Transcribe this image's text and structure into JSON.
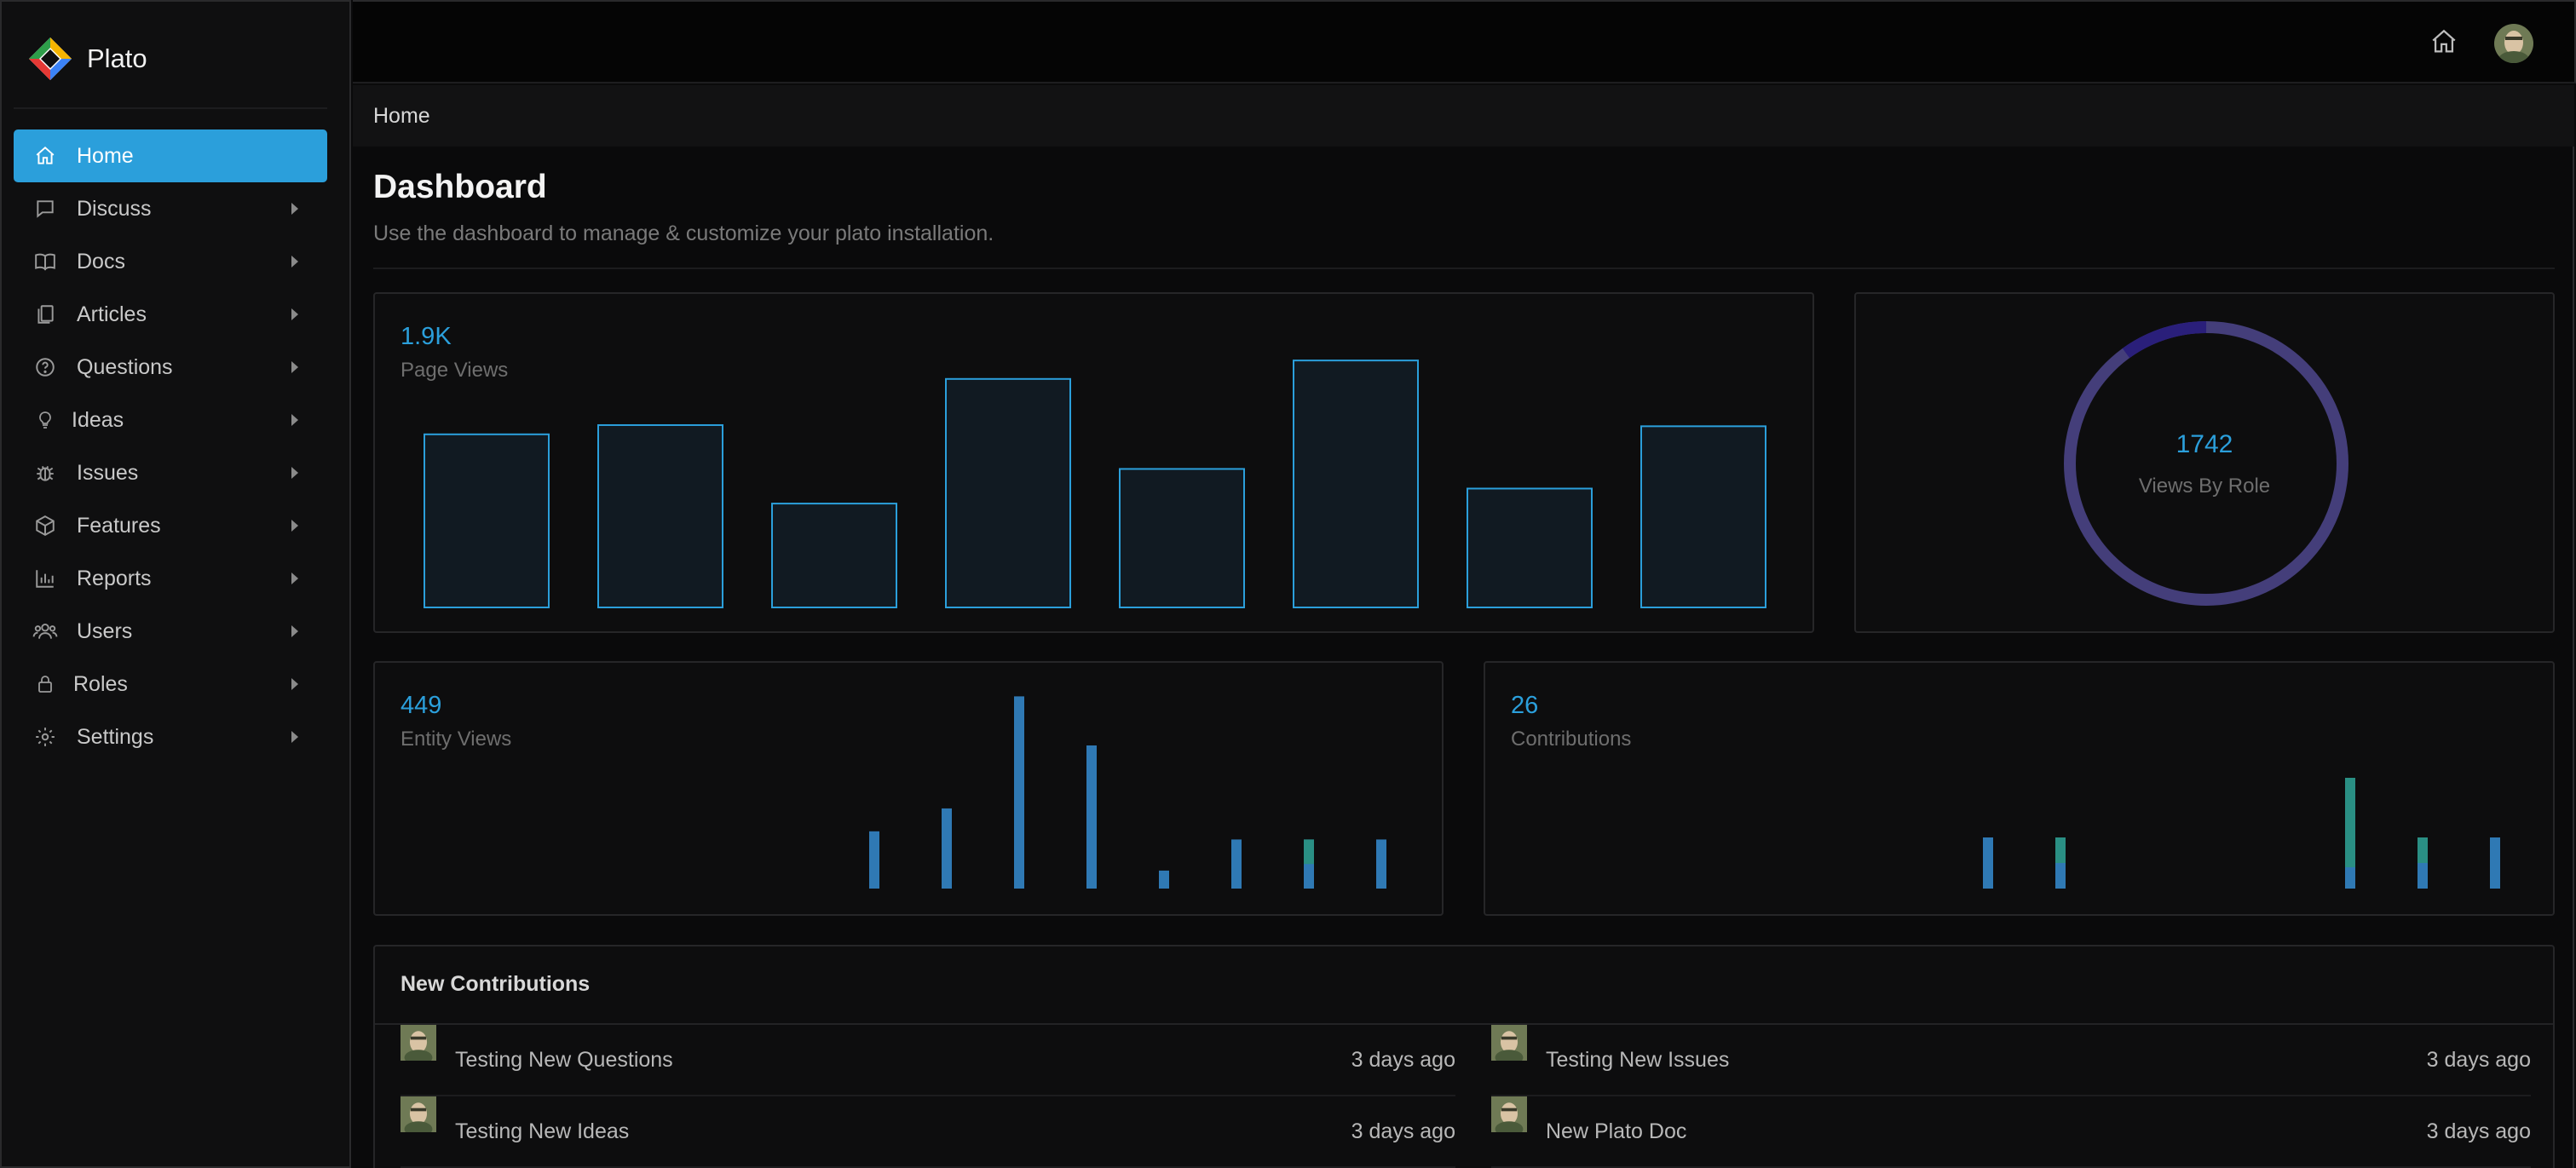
{
  "app": {
    "name": "Plato"
  },
  "sidebar": {
    "items": [
      {
        "label": "Home",
        "icon": "home-icon",
        "active": true,
        "caret": false
      },
      {
        "label": "Discuss",
        "icon": "chat-icon",
        "active": false,
        "caret": true
      },
      {
        "label": "Docs",
        "icon": "book-icon",
        "active": false,
        "caret": true
      },
      {
        "label": "Articles",
        "icon": "documents-icon",
        "active": false,
        "caret": true
      },
      {
        "label": "Questions",
        "icon": "question-icon",
        "active": false,
        "caret": true
      },
      {
        "label": "Ideas",
        "icon": "lightbulb-icon",
        "active": false,
        "caret": true
      },
      {
        "label": "Issues",
        "icon": "bug-icon",
        "active": false,
        "caret": true
      },
      {
        "label": "Features",
        "icon": "cube-icon",
        "active": false,
        "caret": true
      },
      {
        "label": "Reports",
        "icon": "bar-chart-icon",
        "active": false,
        "caret": true
      },
      {
        "label": "Users",
        "icon": "users-icon",
        "active": false,
        "caret": true
      },
      {
        "label": "Roles",
        "icon": "lock-icon",
        "active": false,
        "caret": true
      },
      {
        "label": "Settings",
        "icon": "gear-icon",
        "active": false,
        "caret": true
      }
    ]
  },
  "breadcrumb": {
    "current": "Home"
  },
  "page": {
    "title": "Dashboard",
    "description": "Use the dashboard to manage & customize your plato installation."
  },
  "colors": {
    "accent": "#2b9fdb",
    "donut_ring": "#443e7a",
    "donut_segment": "#2a1f7a",
    "bar_secondary": "#2a8f84"
  },
  "stats": {
    "page_views": {
      "value": "1.9K",
      "label": "Page Views"
    },
    "views_by_role": {
      "value": "1742",
      "label": "Views By Role"
    },
    "entity_views": {
      "value": "449",
      "label": "Entity Views"
    },
    "contributions": {
      "value": "26",
      "label": "Contributions"
    }
  },
  "chart_data": [
    {
      "type": "bar",
      "title": "Page Views",
      "values": [
        150,
        158,
        90,
        198,
        120,
        214,
        103,
        157
      ],
      "ylim": [
        0,
        220
      ]
    },
    {
      "type": "pie",
      "title": "Views By Role",
      "total": 1742,
      "slices": [
        0.9,
        0.1
      ]
    },
    {
      "type": "bar",
      "title": "Entity Views",
      "series": [
        {
          "values": [
            0,
            0,
            0,
            0,
            0,
            0,
            0,
            0,
            0,
            0,
            0,
            70,
            98,
            235,
            175,
            22,
            60,
            60,
            60
          ]
        },
        {
          "values": [
            0,
            0,
            0,
            0,
            0,
            0,
            0,
            0,
            0,
            0,
            0,
            0,
            0,
            0,
            0,
            0,
            0,
            30,
            0
          ]
        }
      ]
    },
    {
      "type": "bar",
      "title": "Contributions",
      "series": [
        {
          "values": [
            0,
            0,
            0,
            0,
            0,
            0,
            0,
            0,
            0,
            0,
            0,
            0,
            0,
            0,
            60,
            60,
            0,
            0,
            0,
            130,
            60,
            60
          ]
        },
        {
          "values": [
            0,
            0,
            0,
            0,
            0,
            0,
            0,
            0,
            0,
            0,
            0,
            0,
            0,
            0,
            0,
            30,
            0,
            0,
            0,
            105,
            30,
            0
          ]
        }
      ]
    }
  ],
  "contributions": {
    "heading": "New Contributions",
    "items": [
      {
        "title": "Testing New Questions",
        "time": "3 days ago"
      },
      {
        "title": "Testing New Issues",
        "time": "3 days ago"
      },
      {
        "title": "Testing New Ideas",
        "time": "3 days ago"
      },
      {
        "title": "New Plato Doc",
        "time": "3 days ago"
      }
    ]
  }
}
